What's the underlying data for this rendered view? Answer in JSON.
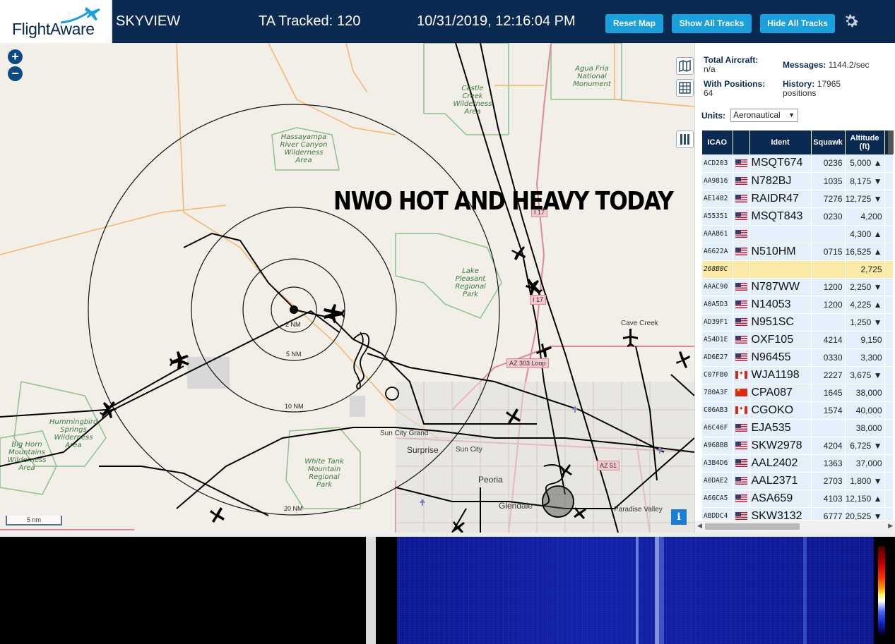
{
  "header": {
    "logo_text": "FlightAware",
    "app_title": "SKYVIEW",
    "ta_label": "TA Tracked:",
    "ta_value": "120",
    "clock": "10/31/2019, 12:16:04 PM",
    "buttons": {
      "reset": "Reset Map",
      "show_all": "Show All Tracks",
      "hide_all": "Hide All Tracks"
    },
    "settings_icon": "gear-icon"
  },
  "map": {
    "zoom_in": "+",
    "zoom_out": "−",
    "overlay_text": "NWO HOT AND HEAVY TODAY",
    "scale_label": "5 nm",
    "info_label": "i",
    "range_rings": [
      "2 NM",
      "5 NM",
      "10 NM",
      "20 NM"
    ],
    "places": {
      "agua_fria": "Agua Fria National Monument",
      "castle_creek": "Castle Creek Wilderness Area",
      "hassayampa": "Hassayampa River Canyon Wilderness Area",
      "lake_pleasant": "Lake Pleasant Regional Park",
      "hummingbird": "Hummingbird Springs Wilderness Area",
      "big_horn": "Big Horn Mountains Wilderness Area",
      "white_tank": "White Tank Mountain Regional Park"
    },
    "cities": {
      "cave_creek": "Cave Creek",
      "sun_city_grand": "Sun City Grand",
      "surprise": "Surprise",
      "sun_city": "Sun City",
      "peoria": "Peoria",
      "glendale": "Glendale",
      "paradise_valley": "Paradise Valley"
    },
    "roads": {
      "az303": "AZ 303 Loop",
      "az51": "AZ 51",
      "i17_a": "I 17",
      "i17_b": "I 17"
    }
  },
  "stats": {
    "total_label": "Total Aircraft:",
    "total_value": "n/a",
    "positions_label": "With Positions:",
    "positions_value": "64",
    "messages_label": "Messages:",
    "messages_value": "1144.2/sec",
    "history_label": "History:",
    "history_value": "17965 positions",
    "units_label": "Units:",
    "units_value": "Aeronautical"
  },
  "table": {
    "headers": {
      "icao": "ICAO",
      "flag": "",
      "ident": "Ident",
      "squawk": "Squawk",
      "altitude": "Altitude (ft)"
    },
    "rows": [
      {
        "icao": "ACD203",
        "flag": "us",
        "ident": "MSQT674",
        "squawk": "0236",
        "alt": "5,000 ▲"
      },
      {
        "icao": "AA9816",
        "flag": "us",
        "ident": "N782BJ",
        "squawk": "1035",
        "alt": "8,175 ▼"
      },
      {
        "icao": "AE1482",
        "flag": "us",
        "ident": "RAIDR47",
        "squawk": "7276",
        "alt": "12,725 ▼"
      },
      {
        "icao": "A55351",
        "flag": "us",
        "ident": "MSQT843",
        "squawk": "0230",
        "alt": "4,200"
      },
      {
        "icao": "AAA861",
        "flag": "us",
        "ident": "",
        "squawk": "",
        "alt": "4,300 ▲"
      },
      {
        "icao": "A6622A",
        "flag": "us",
        "ident": "N510HM",
        "squawk": "0715",
        "alt": "16,525 ▲"
      },
      {
        "icao": "268B0C",
        "flag": "",
        "ident": "",
        "squawk": "",
        "alt": "2,725",
        "selected": true
      },
      {
        "icao": "AAAC90",
        "flag": "us",
        "ident": "N787WW",
        "squawk": "1200",
        "alt": "2,250 ▼"
      },
      {
        "icao": "A0A5D3",
        "flag": "us",
        "ident": "N14053",
        "squawk": "1200",
        "alt": "4,225 ▲"
      },
      {
        "icao": "AD39F1",
        "flag": "us",
        "ident": "N951SC",
        "squawk": "",
        "alt": "1,250 ▼"
      },
      {
        "icao": "A54D1E",
        "flag": "us",
        "ident": "OXF105",
        "squawk": "4214",
        "alt": "9,150"
      },
      {
        "icao": "AD6E27",
        "flag": "us",
        "ident": "N96455",
        "squawk": "0330",
        "alt": "3,300"
      },
      {
        "icao": "C07FB0",
        "flag": "ca",
        "ident": "WJA1198",
        "squawk": "2227",
        "alt": "3,675 ▼"
      },
      {
        "icao": "780A3F",
        "flag": "cn",
        "ident": "CPA087",
        "squawk": "1645",
        "alt": "38,000"
      },
      {
        "icao": "C06AB3",
        "flag": "ca",
        "ident": "CGOKO",
        "squawk": "1574",
        "alt": "40,000"
      },
      {
        "icao": "A6C46F",
        "flag": "us",
        "ident": "EJA535",
        "squawk": "",
        "alt": "38,000"
      },
      {
        "icao": "A968BB",
        "flag": "us",
        "ident": "SKW2978",
        "squawk": "4204",
        "alt": "6,725 ▼"
      },
      {
        "icao": "A3B4D6",
        "flag": "us",
        "ident": "AAL2402",
        "squawk": "1363",
        "alt": "37,000"
      },
      {
        "icao": "A0DAE2",
        "flag": "us",
        "ident": "AAL2371",
        "squawk": "2703",
        "alt": "1,800 ▼"
      },
      {
        "icao": "A66CA5",
        "flag": "us",
        "ident": "ASA659",
        "squawk": "4103",
        "alt": "12,150 ▲"
      },
      {
        "icao": "ABDDC4",
        "flag": "us",
        "ident": "SKW3132",
        "squawk": "6777",
        "alt": "20,525 ▼"
      }
    ]
  },
  "colors": {
    "header_bg": "#0a2a52",
    "button_bg": "#1aa0dc",
    "row_bg": "#e3effa",
    "selected_row_bg": "#fbe9a6",
    "map_bg": "#f1efe8"
  }
}
